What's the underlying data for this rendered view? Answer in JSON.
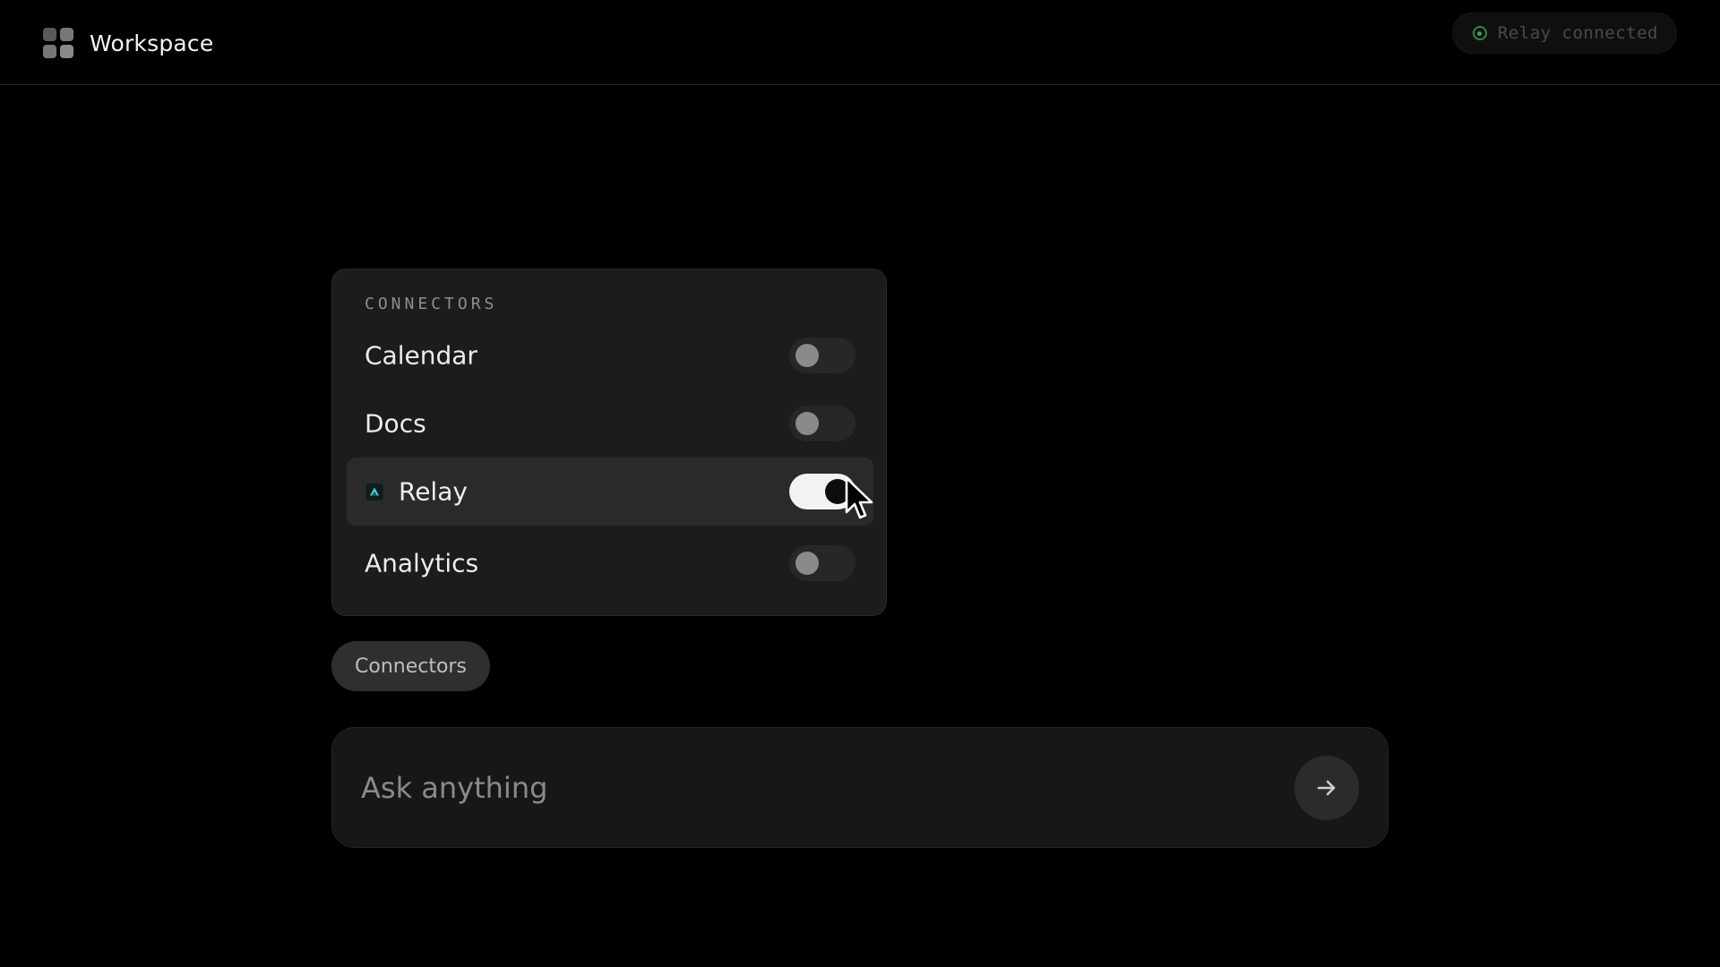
{
  "header": {
    "title": "Workspace",
    "logo_icon": "app-grid-icon",
    "status": {
      "text": "Relay connected",
      "icon": "status-dot-icon",
      "color": "#39a355"
    }
  },
  "connectors_panel": {
    "heading": "CONNECTORS",
    "items": [
      {
        "label": "Calendar",
        "enabled": false,
        "icon": ""
      },
      {
        "label": "Docs",
        "enabled": false,
        "icon": ""
      },
      {
        "label": "Relay",
        "enabled": true,
        "icon": "relay-icon",
        "highlighted": true
      },
      {
        "label": "Analytics",
        "enabled": false,
        "icon": ""
      }
    ]
  },
  "connectors_chip": {
    "label": "Connectors"
  },
  "composer": {
    "placeholder": "Ask anything",
    "value": "",
    "send_icon": "arrow-right-icon"
  },
  "colors": {
    "background": "#000000",
    "panel": "#1c1c1c",
    "toggle_on": "#F2F2F2",
    "toggle_off": "#272727",
    "accent_relay": "#3fd8c3"
  }
}
